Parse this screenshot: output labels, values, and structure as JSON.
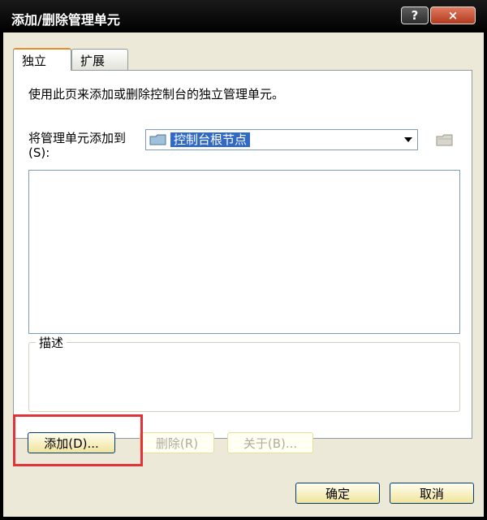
{
  "window": {
    "title": "添加/删除管理单元",
    "help_label": "?",
    "close_label": "×"
  },
  "tabs": [
    {
      "label": "独立"
    },
    {
      "label": "扩展"
    }
  ],
  "panel": {
    "intro": "使用此页来添加或删除控制台的独立管理单元。",
    "add_to_label": "将管理单元添加到(S):",
    "add_to_value": "控制台根节点",
    "description_label": "描述"
  },
  "buttons": {
    "add": "添加(D)...",
    "remove": "删除(R)",
    "about": "关于(B)...",
    "ok": "确定",
    "cancel": "取消"
  },
  "colors": {
    "selection": "#316ac5",
    "highlight_box": "#e0333c"
  }
}
